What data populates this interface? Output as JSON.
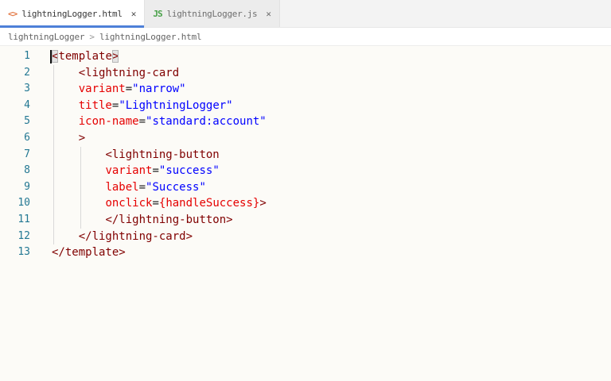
{
  "colors": {
    "accent": "#4e80d8",
    "tag": "#800000",
    "attr": "#e50000",
    "val": "#0000ff",
    "punct": "#1f1f1f",
    "expr": "#e50000",
    "linenum": "#237893",
    "editor-bg": "#fcfbf7"
  },
  "tabs": [
    {
      "id": "html",
      "icon": "html-file-icon",
      "icon_text": "<>",
      "icon_color": "#e37945",
      "label": "lightningLogger.html",
      "close_glyph": "✕",
      "active": true
    },
    {
      "id": "js",
      "icon": "js-file-icon",
      "icon_text": "JS",
      "icon_color": "#47a047",
      "label": "lightningLogger.js",
      "close_glyph": "✕",
      "active": false
    }
  ],
  "breadcrumb": {
    "path": [
      "lightningLogger",
      "lightningLogger.html"
    ],
    "separator": ">"
  },
  "editor": {
    "lines": [
      {
        "num": "1",
        "indent": 0,
        "cursor": true,
        "tokens": [
          [
            "tag hl",
            "<"
          ],
          [
            "tag",
            "template"
          ],
          [
            "tag hl",
            ">"
          ]
        ]
      },
      {
        "num": "2",
        "indent": 4,
        "tokens": [
          [
            "tag",
            "<lightning-card"
          ]
        ]
      },
      {
        "num": "3",
        "indent": 4,
        "tokens": [
          [
            "attr",
            "variant"
          ],
          [
            "punct",
            "="
          ],
          [
            "val",
            "\"narrow\""
          ]
        ]
      },
      {
        "num": "4",
        "indent": 4,
        "tokens": [
          [
            "attr",
            "title"
          ],
          [
            "punct",
            "="
          ],
          [
            "val",
            "\"LightningLogger\""
          ]
        ]
      },
      {
        "num": "5",
        "indent": 4,
        "tokens": [
          [
            "attr",
            "icon-name"
          ],
          [
            "punct",
            "="
          ],
          [
            "val",
            "\"standard:account\""
          ]
        ]
      },
      {
        "num": "6",
        "indent": 4,
        "tokens": [
          [
            "tag",
            ">"
          ]
        ]
      },
      {
        "num": "7",
        "indent": 8,
        "tokens": [
          [
            "tag",
            "<lightning-button"
          ]
        ]
      },
      {
        "num": "8",
        "indent": 8,
        "tokens": [
          [
            "attr",
            "variant"
          ],
          [
            "punct",
            "="
          ],
          [
            "val",
            "\"success\""
          ]
        ]
      },
      {
        "num": "9",
        "indent": 8,
        "tokens": [
          [
            "attr",
            "label"
          ],
          [
            "punct",
            "="
          ],
          [
            "val",
            "\"Success\""
          ]
        ]
      },
      {
        "num": "10",
        "indent": 8,
        "tokens": [
          [
            "attr",
            "onclick"
          ],
          [
            "punct",
            "="
          ],
          [
            "expr",
            "{handleSuccess}"
          ],
          [
            "tag",
            ">"
          ]
        ]
      },
      {
        "num": "11",
        "indent": 8,
        "tokens": [
          [
            "tag",
            "</lightning-button>"
          ]
        ]
      },
      {
        "num": "12",
        "indent": 4,
        "tokens": [
          [
            "tag",
            "</lightning-card>"
          ]
        ]
      },
      {
        "num": "13",
        "indent": 0,
        "tokens": [
          [
            "tag",
            "</template>"
          ]
        ]
      }
    ]
  }
}
